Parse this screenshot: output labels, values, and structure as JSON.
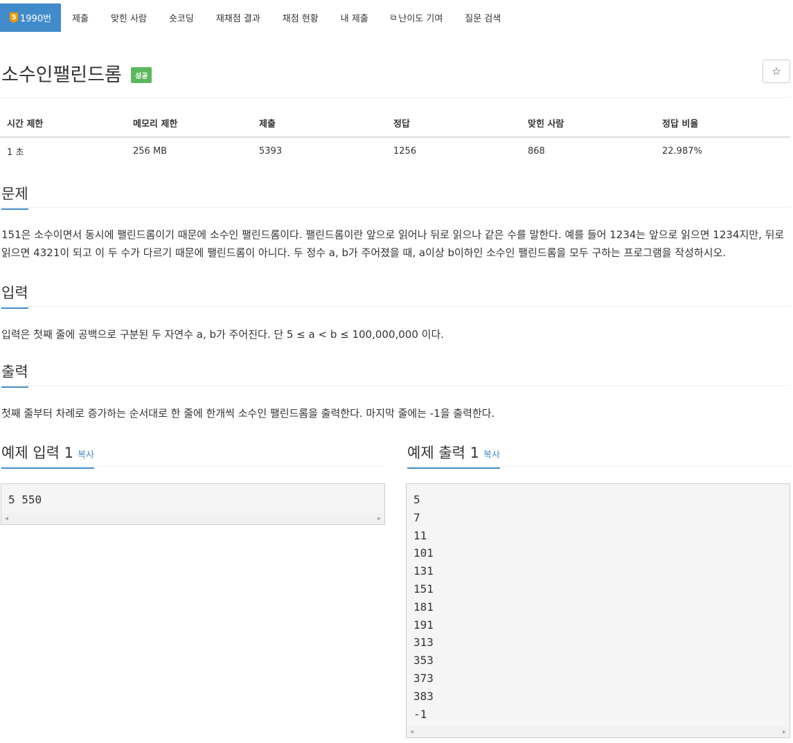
{
  "nav": {
    "tier_label": "5",
    "items": [
      "1990번",
      "제출",
      "맞힌 사람",
      "숏코딩",
      "재채점 결과",
      "채점 현황",
      "내 제출",
      "난이도 기여",
      "질문 검색"
    ]
  },
  "problem": {
    "title": "소수인팰린드롬",
    "status_badge": "성공",
    "star_icon": "☆"
  },
  "stats": {
    "headers": [
      "시간 제한",
      "메모리 제한",
      "제출",
      "정답",
      "맞힌 사람",
      "정답 비율"
    ],
    "values": [
      "1 초",
      "256 MB",
      "5393",
      "1256",
      "868",
      "22.987%"
    ]
  },
  "sections": {
    "problem_heading": "문제",
    "problem_text": "151은 소수이면서 동시에 팰린드롬이기 때문에 소수인 팰린드롬이다. 팰린드롬이란 앞으로 읽어나 뒤로 읽으나 같은 수를 말한다. 예를 들어 1234는 앞으로 읽으면 1234지만, 뒤로 읽으면 4321이 되고 이 두 수가 다르기 때문에 팰린드롬이 아니다. 두 정수 a, b가 주어졌을 때, a이상 b이하인 소수인 팰린드롬을 모두 구하는 프로그램을 작성하시오.",
    "input_heading": "입력",
    "input_text": "입력은 첫째 줄에 공백으로 구분된 두 자연수 a, b가 주어진다. 단 5 ≤ a < b ≤ 100,000,000 이다.",
    "output_heading": "출력",
    "output_text": "첫째 줄부터 차례로 증가하는 순서대로 한 줄에 한개씩 소수인 팰린드롬을 출력한다. 마지막 줄에는 -1을 출력한다."
  },
  "samples": {
    "input_heading": "예제 입력 1",
    "output_heading": "예제 출력 1",
    "copy_label": "복사",
    "input_lines": [
      "5 550"
    ],
    "output_lines": [
      "5",
      "7",
      "11",
      "101",
      "131",
      "151",
      "181",
      "191",
      "313",
      "353",
      "373",
      "383",
      "-1"
    ]
  },
  "colors": {
    "accent": "#428bca",
    "success": "#5cb85c",
    "tier_gold": "#ec9a00"
  }
}
